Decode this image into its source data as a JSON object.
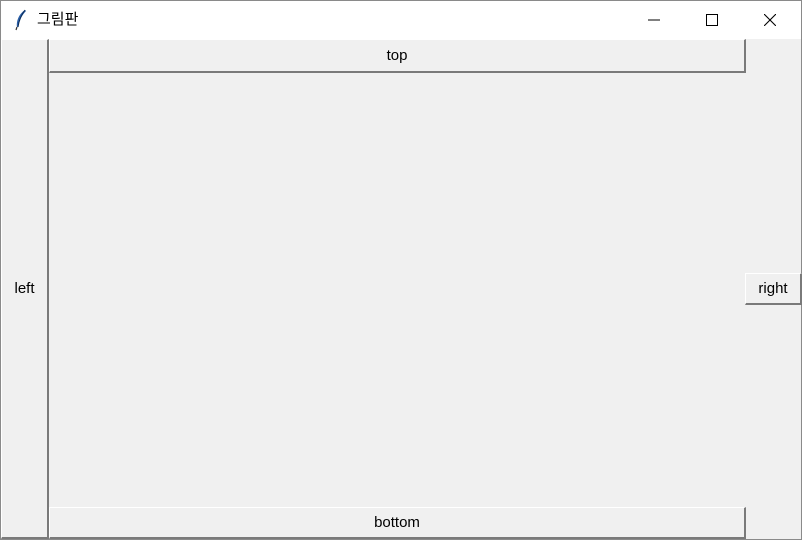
{
  "window": {
    "title": "그림판",
    "app_icon": "tk-feather-icon",
    "controls": {
      "minimize_icon": "minimize-icon",
      "maximize_icon": "maximize-icon",
      "close_icon": "close-icon"
    }
  },
  "buttons": {
    "top": "top",
    "left": "left",
    "right": "right",
    "bottom": "bottom"
  },
  "colors": {
    "background": "#f0f0f0",
    "titlebar": "#ffffff",
    "button_shadow": "#7a7a7a"
  }
}
